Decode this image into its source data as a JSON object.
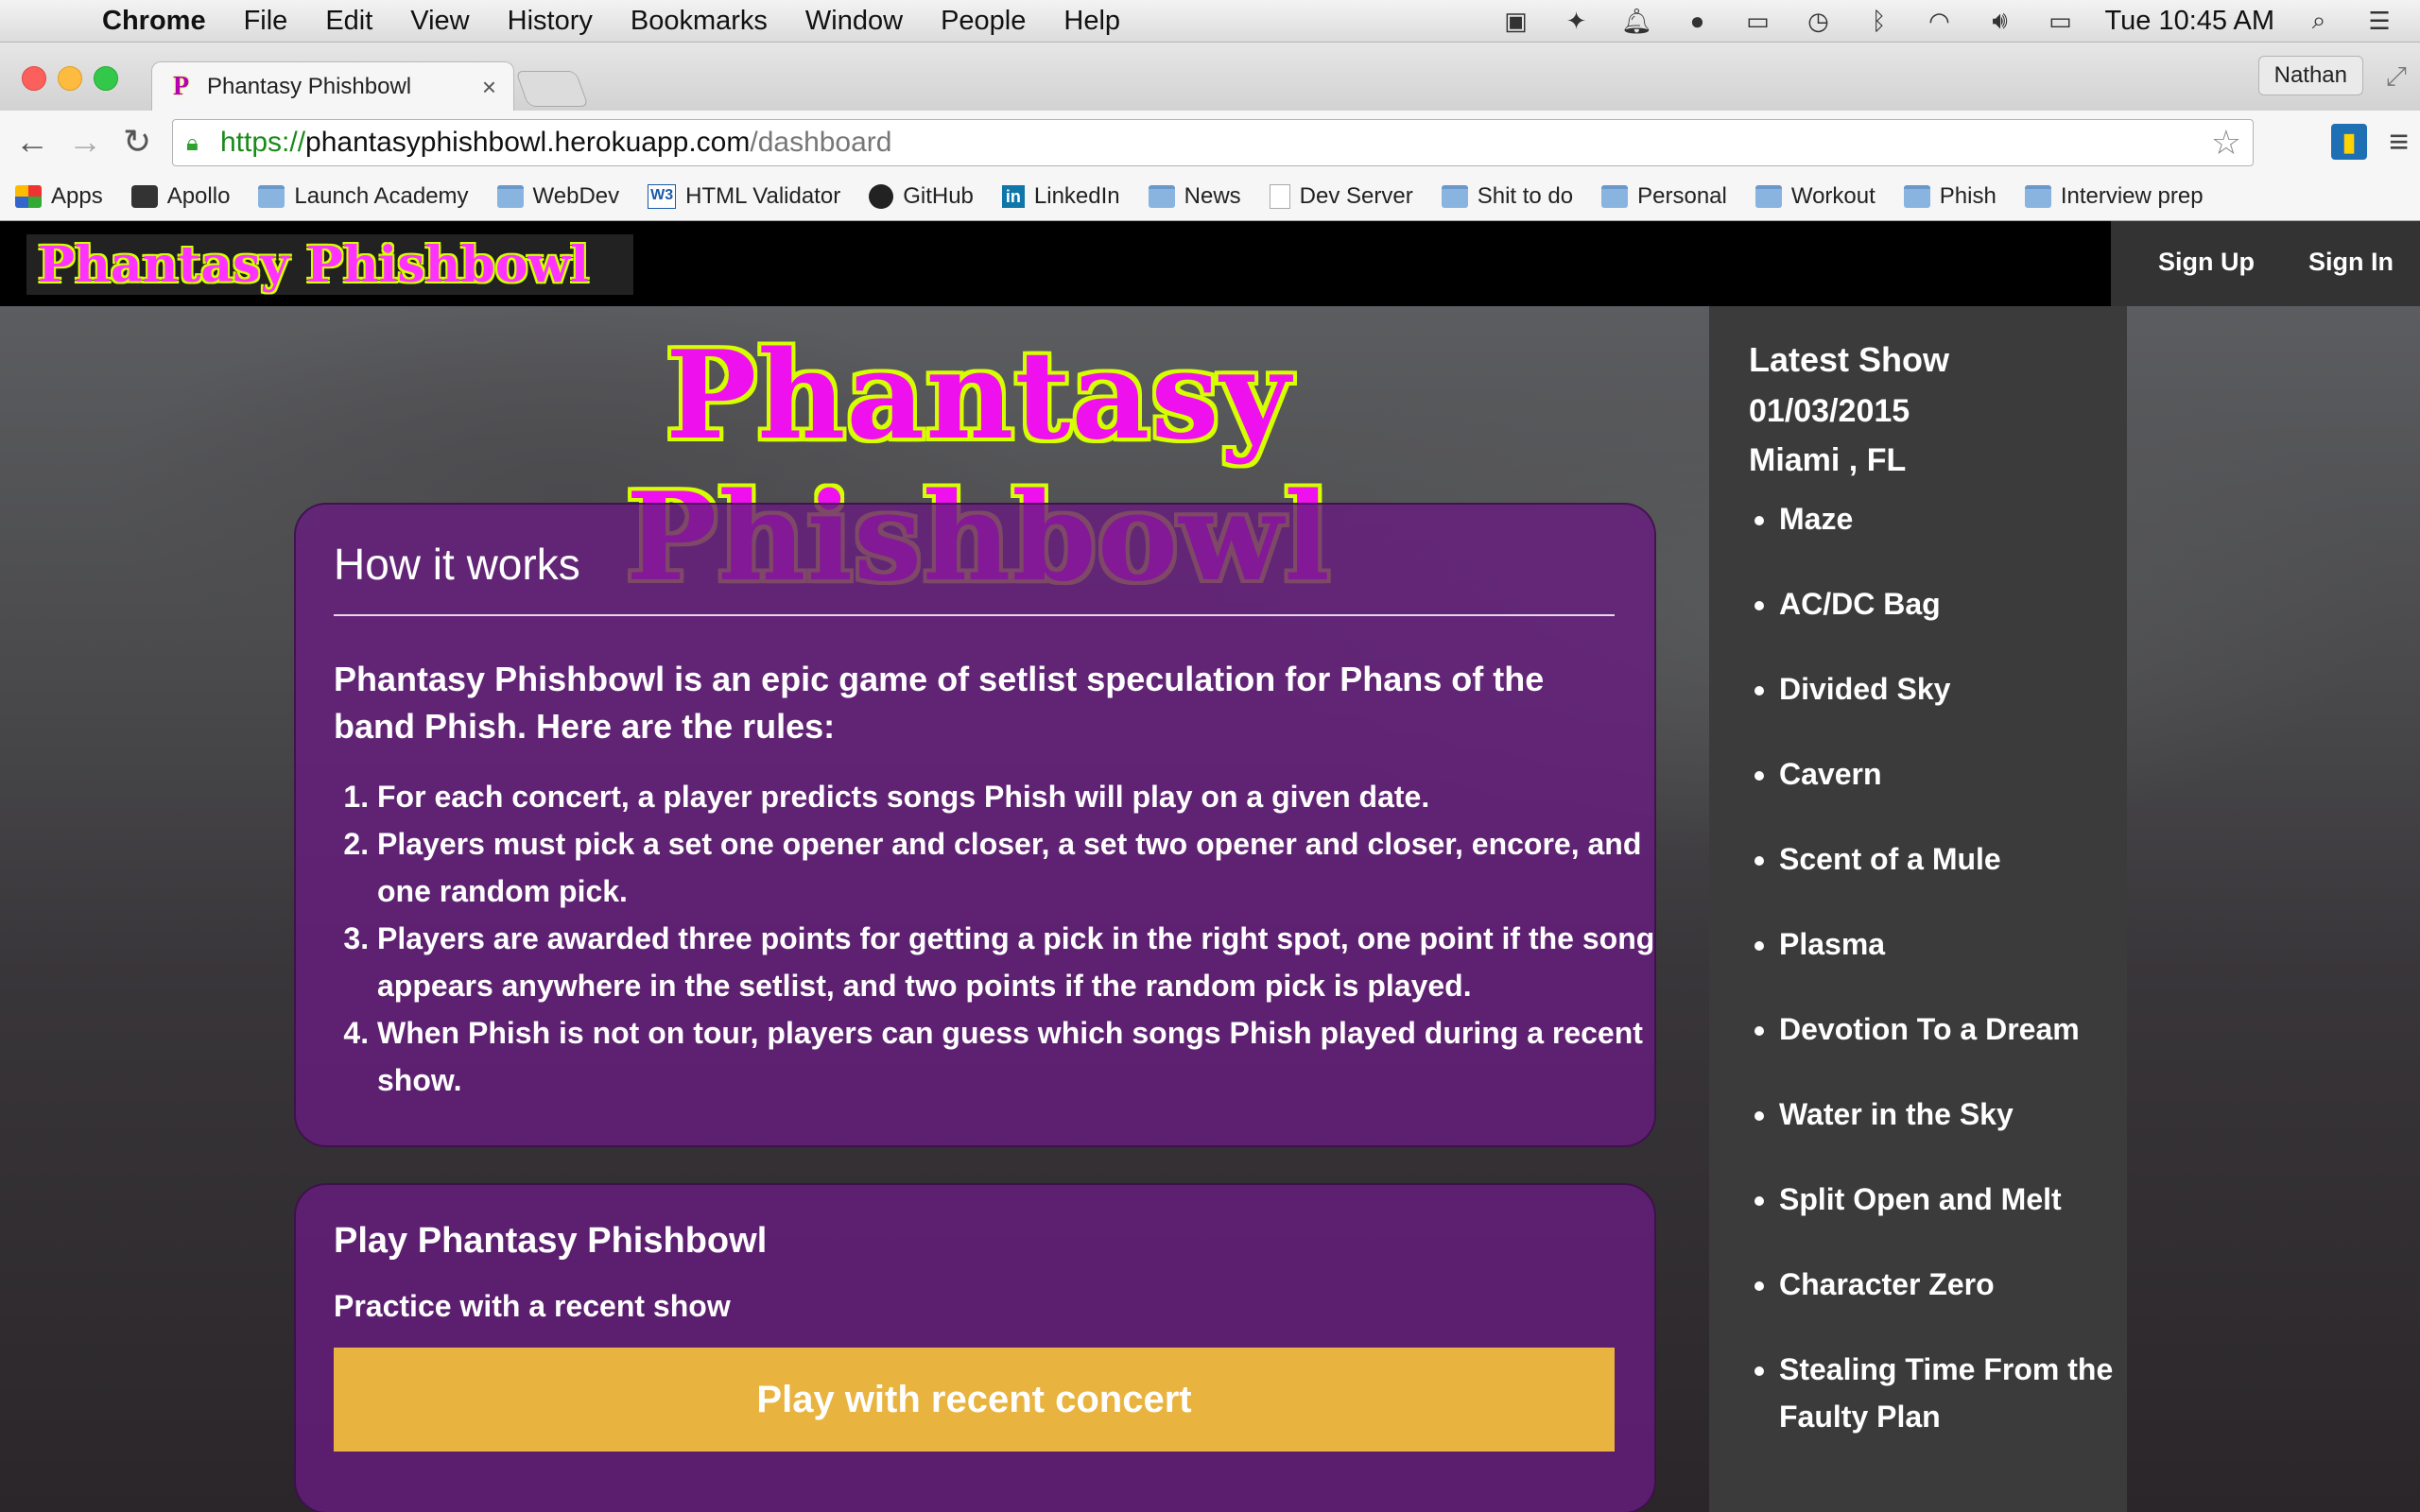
{
  "os_menubar": {
    "app_name": "Chrome",
    "menus": [
      "File",
      "Edit",
      "View",
      "History",
      "Bookmarks",
      "Window",
      "People",
      "Help"
    ],
    "clock": "Tue 10:45 AM"
  },
  "browser": {
    "tab_title": "Phantasy Phishbowl",
    "profile_name": "Nathan",
    "url": {
      "scheme": "https://",
      "host": "phantasyphishbowl.herokuapp.com",
      "path": "/dashboard"
    },
    "bookmarks": [
      {
        "label": "Apps",
        "icon": "apps-grid-icon"
      },
      {
        "label": "Apollo",
        "icon": "apollo-icon"
      },
      {
        "label": "Launch Academy",
        "icon": "folder-icon"
      },
      {
        "label": "WebDev",
        "icon": "folder-icon"
      },
      {
        "label": "HTML Validator",
        "icon": "w3c-icon"
      },
      {
        "label": "GitHub",
        "icon": "github-icon"
      },
      {
        "label": "LinkedIn",
        "icon": "linkedin-icon"
      },
      {
        "label": "News",
        "icon": "folder-icon"
      },
      {
        "label": "Dev Server",
        "icon": "page-icon"
      },
      {
        "label": "Shit to do",
        "icon": "folder-icon"
      },
      {
        "label": "Personal",
        "icon": "folder-icon"
      },
      {
        "label": "Workout",
        "icon": "folder-icon"
      },
      {
        "label": "Phish",
        "icon": "folder-icon"
      },
      {
        "label": "Interview prep",
        "icon": "folder-icon"
      }
    ]
  },
  "site": {
    "logo_text": "Phantasy Phishbowl",
    "nav": {
      "sign_up": "Sign Up",
      "sign_in": "Sign In"
    },
    "hero_title": "Phantasy Phishbowl",
    "how_it_works": {
      "heading": "How it works",
      "intro": "Phantasy Phishbowl is an epic game of setlist speculation for Phans of the band Phish. Here are the rules:",
      "rules": [
        "For each concert, a player predicts songs Phish will play on a given date.",
        "Players must pick a set one opener and closer, a set two opener and closer, encore, and one random pick.",
        "Players are awarded three points for getting a pick in the right spot, one point if the song appears anywhere in the setlist, and two points if the random pick is played.",
        "When Phish is not on tour, players can guess which songs Phish played during a recent show."
      ]
    },
    "play": {
      "heading": "Play Phantasy Phishbowl",
      "subheading": "Practice with a recent show",
      "button_label": "Play with recent concert"
    },
    "latest_show": {
      "heading": "Latest Show",
      "date": "01/03/2015",
      "location": "Miami , FL",
      "songs": [
        "Maze",
        "AC/DC Bag",
        "Divided Sky",
        "Cavern",
        "Scent of a Mule",
        "Plasma",
        "Devotion To a Dream",
        "Water in the Sky",
        "Split Open and Melt",
        "Character Zero",
        "Stealing Time From the Faulty Plan"
      ]
    }
  },
  "colors": {
    "logo_magenta": "#ee11ee",
    "logo_outline": "#d6ff00",
    "panel_purple": "#681c80",
    "button_gold": "#e9b33f",
    "sidebar_gray": "#3b3b3b"
  }
}
